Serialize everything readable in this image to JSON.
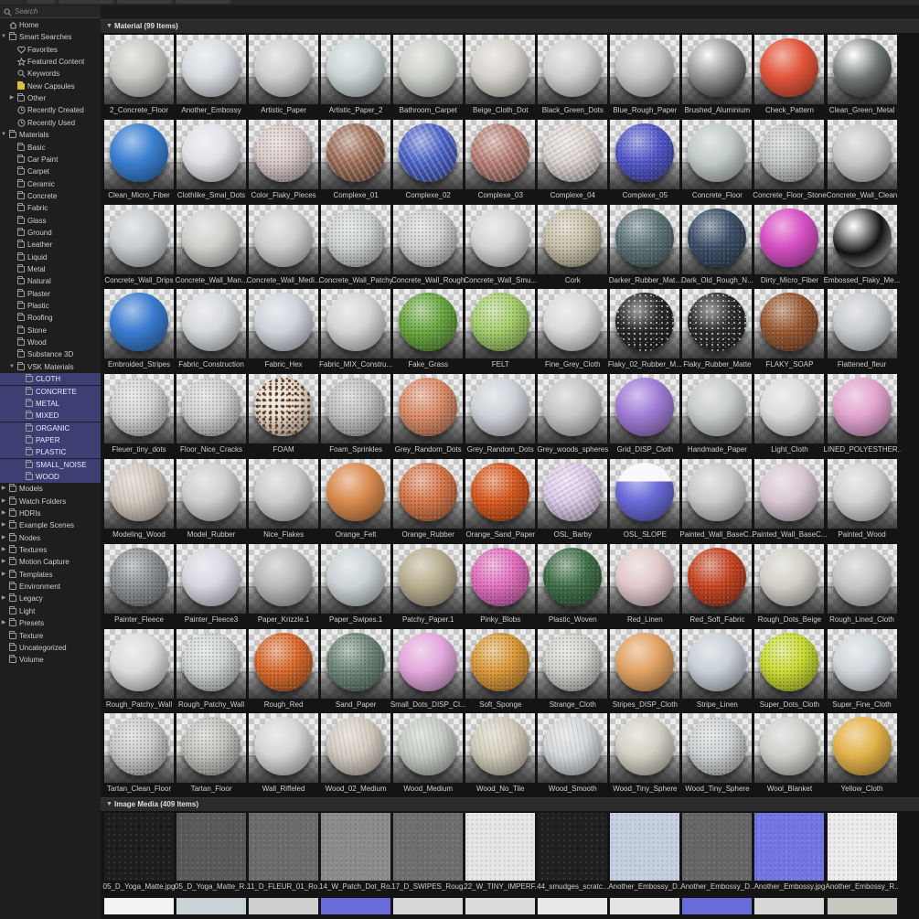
{
  "search": {
    "placeholder": "Search"
  },
  "sidebar": {
    "items": [
      {
        "label": "Home",
        "level": 0,
        "arrow": "none",
        "icon": "home-icon"
      },
      {
        "label": "Smart Searches",
        "level": 0,
        "arrow": "down",
        "icon": "folder-icon"
      },
      {
        "label": "Favorites",
        "level": 1,
        "arrow": "none",
        "icon": "heart-icon"
      },
      {
        "label": "Featured Content",
        "level": 1,
        "arrow": "none",
        "icon": "star-icon"
      },
      {
        "label": "Keywords",
        "level": 1,
        "arrow": "none",
        "icon": "search-icon"
      },
      {
        "label": "New Capsules",
        "level": 1,
        "arrow": "none",
        "icon": "capsule-folder-icon"
      },
      {
        "label": "Other",
        "level": 1,
        "arrow": "right",
        "icon": "folder-icon"
      },
      {
        "label": "Recently Created",
        "level": 1,
        "arrow": "none",
        "icon": "clock-icon"
      },
      {
        "label": "Recently Used",
        "level": 1,
        "arrow": "none",
        "icon": "clock-icon"
      },
      {
        "label": "Materials",
        "level": 0,
        "arrow": "down",
        "icon": "folder-icon"
      },
      {
        "label": "Basic",
        "level": 1,
        "arrow": "none",
        "icon": "folder-icon"
      },
      {
        "label": "Car Paint",
        "level": 1,
        "arrow": "none",
        "icon": "folder-icon"
      },
      {
        "label": "Carpet",
        "level": 1,
        "arrow": "none",
        "icon": "folder-icon"
      },
      {
        "label": "Ceramic",
        "level": 1,
        "arrow": "none",
        "icon": "folder-icon"
      },
      {
        "label": "Concrete",
        "level": 1,
        "arrow": "none",
        "icon": "folder-icon"
      },
      {
        "label": "Fabric",
        "level": 1,
        "arrow": "none",
        "icon": "folder-icon"
      },
      {
        "label": "Glass",
        "level": 1,
        "arrow": "none",
        "icon": "folder-icon"
      },
      {
        "label": "Ground",
        "level": 1,
        "arrow": "none",
        "icon": "folder-icon"
      },
      {
        "label": "Leather",
        "level": 1,
        "arrow": "none",
        "icon": "folder-icon"
      },
      {
        "label": "Liquid",
        "level": 1,
        "arrow": "none",
        "icon": "folder-icon"
      },
      {
        "label": "Metal",
        "level": 1,
        "arrow": "none",
        "icon": "folder-icon"
      },
      {
        "label": "Natural",
        "level": 1,
        "arrow": "none",
        "icon": "folder-icon"
      },
      {
        "label": "Plaster",
        "level": 1,
        "arrow": "none",
        "icon": "folder-icon"
      },
      {
        "label": "Plastic",
        "level": 1,
        "arrow": "none",
        "icon": "folder-icon"
      },
      {
        "label": "Roofing",
        "level": 1,
        "arrow": "none",
        "icon": "folder-icon"
      },
      {
        "label": "Stone",
        "level": 1,
        "arrow": "none",
        "icon": "folder-icon"
      },
      {
        "label": "Wood",
        "level": 1,
        "arrow": "none",
        "icon": "folder-icon"
      },
      {
        "label": "Substance 3D",
        "level": 1,
        "arrow": "none",
        "icon": "folder-icon"
      },
      {
        "label": "VSK Materials",
        "level": 1,
        "arrow": "down",
        "icon": "folder-icon"
      },
      {
        "label": "CLOTH",
        "level": 2,
        "arrow": "none",
        "icon": "folder-icon",
        "selected": true
      },
      {
        "label": "CONCRETE",
        "level": 2,
        "arrow": "none",
        "icon": "folder-icon",
        "selected": true
      },
      {
        "label": "METAL",
        "level": 2,
        "arrow": "none",
        "icon": "folder-icon",
        "selected": true
      },
      {
        "label": "MIXED",
        "level": 2,
        "arrow": "none",
        "icon": "folder-icon",
        "selected": true
      },
      {
        "label": "ORGANIC",
        "level": 2,
        "arrow": "none",
        "icon": "folder-icon",
        "selected": true
      },
      {
        "label": "PAPER",
        "level": 2,
        "arrow": "none",
        "icon": "folder-icon",
        "selected": true
      },
      {
        "label": "PLASTIC",
        "level": 2,
        "arrow": "none",
        "icon": "folder-icon",
        "selected": true
      },
      {
        "label": "SMALL_NOISE",
        "level": 2,
        "arrow": "none",
        "icon": "folder-icon",
        "selected": true
      },
      {
        "label": "WOOD",
        "level": 2,
        "arrow": "none",
        "icon": "folder-icon",
        "selected": true
      },
      {
        "label": "Models",
        "level": 0,
        "arrow": "right",
        "icon": "folder-icon"
      },
      {
        "label": "Watch Folders",
        "level": 0,
        "arrow": "right",
        "icon": "folder-icon"
      },
      {
        "label": "HDRIs",
        "level": 0,
        "arrow": "right",
        "icon": "folder-icon"
      },
      {
        "label": "Example Scenes",
        "level": 0,
        "arrow": "right",
        "icon": "folder-icon"
      },
      {
        "label": "Nodes",
        "level": 0,
        "arrow": "right",
        "icon": "folder-icon"
      },
      {
        "label": "Textures",
        "level": 0,
        "arrow": "right",
        "icon": "folder-icon"
      },
      {
        "label": "Motion Capture",
        "level": 0,
        "arrow": "right",
        "icon": "folder-icon"
      },
      {
        "label": "Templates",
        "level": 0,
        "arrow": "right",
        "icon": "folder-icon"
      },
      {
        "label": "Environment",
        "level": 0,
        "arrow": "none",
        "icon": "folder-icon"
      },
      {
        "label": "Legacy",
        "level": 0,
        "arrow": "right",
        "icon": "folder-icon"
      },
      {
        "label": "Light",
        "level": 0,
        "arrow": "none",
        "icon": "folder-icon"
      },
      {
        "label": "Presets",
        "level": 0,
        "arrow": "right",
        "icon": "folder-icon"
      },
      {
        "label": "Texture",
        "level": 0,
        "arrow": "none",
        "icon": "folder-icon"
      },
      {
        "label": "Uncategorized",
        "level": 0,
        "arrow": "none",
        "icon": "folder-icon"
      },
      {
        "label": "Volume",
        "level": 0,
        "arrow": "none",
        "icon": "folder-icon"
      }
    ]
  },
  "material_section": {
    "title": "Material (99 Items)"
  },
  "materials": [
    {
      "name": "2_Concrete_Floor",
      "color": "#c9cbc6",
      "style": "matte"
    },
    {
      "name": "Another_Embossy",
      "color": "#d9dde2",
      "style": "matte"
    },
    {
      "name": "Artistic_Paper",
      "color": "#cfd0cf",
      "style": "matte"
    },
    {
      "name": "Artistic_Paper_2",
      "color": "#cbd6d7",
      "style": "matte"
    },
    {
      "name": "Bathroom_Carpet",
      "color": "#cdd1cb",
      "style": "matte"
    },
    {
      "name": "Beige_Cloth_Dot",
      "color": "#d6d3cd",
      "style": "matte"
    },
    {
      "name": "Black_Green_Dots",
      "color": "#d0d2d1",
      "style": "matte"
    },
    {
      "name": "Blue_Rough_Paper",
      "color": "#c7c8c9",
      "style": "matte"
    },
    {
      "name": "Brushed_Aluminium",
      "color": "#8e8e8e",
      "style": "metal"
    },
    {
      "name": "Check_Pattern",
      "color": "#e2553a",
      "style": "matte"
    },
    {
      "name": "Clean_Green_Metal",
      "color": "#6d7570",
      "style": "metal"
    },
    {
      "name": "Clean_Micro_Fiber",
      "color": "#3a7fd0",
      "style": "matte"
    },
    {
      "name": "Clothlike_Smal_Dots",
      "color": "#e0e2e8",
      "style": "matte"
    },
    {
      "name": "Color_Flaky_Pieces",
      "color": "#d8c9c6",
      "style": "speckle"
    },
    {
      "name": "Complexe_01",
      "color": "#9c6b55",
      "style": "marble"
    },
    {
      "name": "Complexe_02",
      "color": "#4a62c8",
      "style": "marble"
    },
    {
      "name": "Complexe_03",
      "color": "#b57c72",
      "style": "marble"
    },
    {
      "name": "Complexe_04",
      "color": "#d9d2cf",
      "style": "marble"
    },
    {
      "name": "Complexe_05",
      "color": "#5358cc",
      "style": "speckle"
    },
    {
      "name": "Concrete_Floor",
      "color": "#c2cbc6",
      "style": "matte"
    },
    {
      "name": "Concrete_Floor_Stone",
      "color": "#c4c8c6",
      "style": "speckle"
    },
    {
      "name": "Concrete_Wall_Clean",
      "color": "#c8cac8",
      "style": "matte"
    },
    {
      "name": "Concrete_Wall_Drips",
      "color": "#c9cdd0",
      "style": "matte"
    },
    {
      "name": "Concrete_Wall_Man...",
      "color": "#cfd1cd",
      "style": "matte"
    },
    {
      "name": "Concrete_Wall_Medi...",
      "color": "#cecfcd",
      "style": "matte"
    },
    {
      "name": "Concrete_Wall_Patchy",
      "color": "#cfd2d3",
      "style": "speckle"
    },
    {
      "name": "Concrete_Wall_Rough",
      "color": "#ced0cf",
      "style": "speckle"
    },
    {
      "name": "Concrete_Wall_Smu...",
      "color": "#d5d6d4",
      "style": "matte"
    },
    {
      "name": "Cork",
      "color": "#c8c0a8",
      "style": "speckle"
    },
    {
      "name": "Darker_Rubber_Mat...",
      "color": "#5f7478",
      "style": "speckle"
    },
    {
      "name": "Dark_Old_Rough_N...",
      "color": "#3e506a",
      "style": "speckle"
    },
    {
      "name": "Dirty_Micro_Fiber",
      "color": "#d64fc3",
      "style": "matte"
    },
    {
      "name": "Embossed_Flaky_Me...",
      "color": "#303030",
      "style": "chrome"
    },
    {
      "name": "Embroided_Stripes",
      "color": "#3a7cd0",
      "style": "matte"
    },
    {
      "name": "Fabric_Construction",
      "color": "#d7dadd",
      "style": "matte"
    },
    {
      "name": "Fabric_Hex",
      "color": "#d0d4db",
      "style": "matte"
    },
    {
      "name": "Fabric_MIX_Constru...",
      "color": "#d4d6d6",
      "style": "matte"
    },
    {
      "name": "Fake_Grass",
      "color": "#6aa840",
      "style": "speckle"
    },
    {
      "name": "FELT",
      "color": "#a4cf6a",
      "style": "speckle"
    },
    {
      "name": "Fine_Grey_Cloth",
      "color": "#d9dbd9",
      "style": "matte"
    },
    {
      "name": "Flaky_02_Rubber_M...",
      "color": "#262626",
      "style": "dots"
    },
    {
      "name": "Flaky_Rubber_Matte",
      "color": "#2b2b2b",
      "style": "dots"
    },
    {
      "name": "FLAKY_SOAP",
      "color": "#9a5a33",
      "style": "speckle"
    },
    {
      "name": "Flattened_fleur",
      "color": "#c9ccd0",
      "style": "matte"
    },
    {
      "name": "Fleuer_tiny_dots",
      "color": "#d2d4d2",
      "style": "speckle"
    },
    {
      "name": "Floor_Nice_Cracks",
      "color": "#cfd0cf",
      "style": "speckle"
    },
    {
      "name": "FOAM",
      "color": "#e2dcd3",
      "style": "foam"
    },
    {
      "name": "Foam_Sprinkles",
      "color": "#bfc1bf",
      "style": "speckle"
    },
    {
      "name": "Grey_Random_Dots",
      "color": "#dc8c68",
      "style": "speckle"
    },
    {
      "name": "Grey_Random_Dots",
      "color": "#cfd2d8",
      "style": "matte"
    },
    {
      "name": "Grey_woods_spheres",
      "color": "#c5c7c6",
      "style": "matte"
    },
    {
      "name": "Grid_DISP_Cloth",
      "color": "#a07cd6",
      "style": "matte"
    },
    {
      "name": "Handmade_Paper",
      "color": "#c8ccc8",
      "style": "matte"
    },
    {
      "name": "Light_Cloth",
      "color": "#dcdcdc",
      "style": "matte"
    },
    {
      "name": "LINED_POLYESTHER...",
      "color": "#e2a3cf",
      "style": "matte"
    },
    {
      "name": "Modeling_Wood",
      "color": "#d2c8bf",
      "style": "wood"
    },
    {
      "name": "Model_Rubber",
      "color": "#cfcfcd",
      "style": "matte"
    },
    {
      "name": "Nice_Flakes",
      "color": "#cbcccb",
      "style": "matte"
    },
    {
      "name": "Orange_Felt",
      "color": "#d98a4e",
      "style": "matte"
    },
    {
      "name": "Orange_Rubber",
      "color": "#d7784a",
      "style": "speckle"
    },
    {
      "name": "Orange_Sand_Paper",
      "color": "#da5a1f",
      "style": "speckle"
    },
    {
      "name": "OSL_Barby",
      "color": "#d9c8e6",
      "style": "marble"
    },
    {
      "name": "OSL_SLOPE",
      "color": "#6a6ad8",
      "style": "slope"
    },
    {
      "name": "Painted_Wall_BaseC...",
      "color": "#c9cbc9",
      "style": "matte"
    },
    {
      "name": "Painted_Wall_BaseC...",
      "color": "#d8c8d4",
      "style": "matte"
    },
    {
      "name": "Painted_Wood",
      "color": "#d2d4d4",
      "style": "matte"
    },
    {
      "name": "Painter_Fleece",
      "color": "#8c9093",
      "style": "speckle"
    },
    {
      "name": "Painter_Fleece3",
      "color": "#d7d7e0",
      "style": "matte"
    },
    {
      "name": "Paper_Krizzle.1",
      "color": "#b9bbb9",
      "style": "matte"
    },
    {
      "name": "Paper_Swipes.1",
      "color": "#cbd3d6",
      "style": "matte"
    },
    {
      "name": "Patchy_Paper.1",
      "color": "#b7ad90",
      "style": "matte"
    },
    {
      "name": "Pinky_Blobs",
      "color": "#e36fbf",
      "style": "speckle"
    },
    {
      "name": "Plastic_Woven",
      "color": "#3f6f48",
      "style": "speckle"
    },
    {
      "name": "Red_Linen",
      "color": "#e2c9cb",
      "style": "matte"
    },
    {
      "name": "Red_Soft_Fabric",
      "color": "#c84422",
      "style": "speckle"
    },
    {
      "name": "Rough_Dots_Beige",
      "color": "#d3d0c8",
      "style": "matte"
    },
    {
      "name": "Rough_Lined_Cloth",
      "color": "#c6c7c5",
      "style": "matte"
    },
    {
      "name": "Rough_Patchy_Wall",
      "color": "#dcdcdc",
      "style": "matte"
    },
    {
      "name": "Rough_Patchy_Wall",
      "color": "#cfd4d2",
      "style": "speckle"
    },
    {
      "name": "Rough_Red",
      "color": "#da6a2c",
      "style": "speckle"
    },
    {
      "name": "Sand_Paper",
      "color": "#6e8679",
      "style": "speckle"
    },
    {
      "name": "Small_Dots_DISP_Cl...",
      "color": "#e3a7dc",
      "style": "matte"
    },
    {
      "name": "Soft_Sponge",
      "color": "#dc9a3a",
      "style": "speckle"
    },
    {
      "name": "Strange_Cloth",
      "color": "#cfd3cc",
      "style": "speckle"
    },
    {
      "name": "Stripes_DISP_Cloth",
      "color": "#e0a263",
      "style": "matte"
    },
    {
      "name": "Stripe_Linen",
      "color": "#c9d0d8",
      "style": "matte"
    },
    {
      "name": "Super_Dots_Cloth",
      "color": "#c8dc32",
      "style": "speckle"
    },
    {
      "name": "Super_Fine_Cloth",
      "color": "#d2d7dc",
      "style": "matte"
    },
    {
      "name": "Tartan_Clean_Floor",
      "color": "#c8cacb",
      "style": "speckle"
    },
    {
      "name": "Tartan_Floor",
      "color": "#bfc2bd",
      "style": "speckle"
    },
    {
      "name": "Wall_Riffeled",
      "color": "#d5d6d6",
      "style": "matte"
    },
    {
      "name": "Wood_02_Medium",
      "color": "#d2ccc2",
      "style": "wood"
    },
    {
      "name": "Wood_Medium",
      "color": "#c6cbc6",
      "style": "wood"
    },
    {
      "name": "Wood_No_Tile",
      "color": "#d1ccbc",
      "style": "wood"
    },
    {
      "name": "Wood_Smooth",
      "color": "#d4d8db",
      "style": "wood"
    },
    {
      "name": "Wood_Tiny_Sphere",
      "color": "#d3d1c4",
      "style": "matte"
    },
    {
      "name": "Wood_Tiny_Sphere",
      "color": "#cfd2d4",
      "style": "speckle"
    },
    {
      "name": "Wool_Blanket",
      "color": "#cfd0cb",
      "style": "matte"
    },
    {
      "name": "Yellow_Cloth",
      "color": "#e2b24a",
      "style": "matte"
    }
  ],
  "image_section": {
    "title": "Image Media (409 Items)"
  },
  "images": [
    {
      "name": "05_D_Yoga_Matte.jpg",
      "color": "#1e1e1e",
      "row2": "#f2f2f2"
    },
    {
      "name": "05_D_Yoga_Matte_R...",
      "color": "#5a5a5a",
      "row2": "#c9d2d4"
    },
    {
      "name": "11_D_FLEUR_01_Ro...",
      "color": "#6c6c6c",
      "row2": "#cfcfcf"
    },
    {
      "name": "14_W_Patch_Dot_Ro...",
      "color": "#8c8c8c",
      "row2": "#6a6ad8"
    },
    {
      "name": "17_D_SWIPES_Roug...",
      "color": "#6f6f6f",
      "row2": "#d8d8d8"
    },
    {
      "name": "22_W_TINY_IMPERF...",
      "color": "#e6e6e6",
      "row2": "#dcdcdc"
    },
    {
      "name": "44_smudges_scratc...",
      "color": "#202020",
      "row2": "#e8e8e8"
    },
    {
      "name": "Another_Embossy_D...",
      "color": "#c6cfe0",
      "row2": "#e4e4e4"
    },
    {
      "name": "Another_Embossy_D...",
      "color": "#666666",
      "row2": "#6a6ad8"
    },
    {
      "name": "Another_Embossy.jpg",
      "color": "#7476e6",
      "row2": "#d6d9d6"
    },
    {
      "name": "Another_Embossy_R...",
      "color": "#ececec",
      "row2": "#c4c8c0"
    }
  ]
}
